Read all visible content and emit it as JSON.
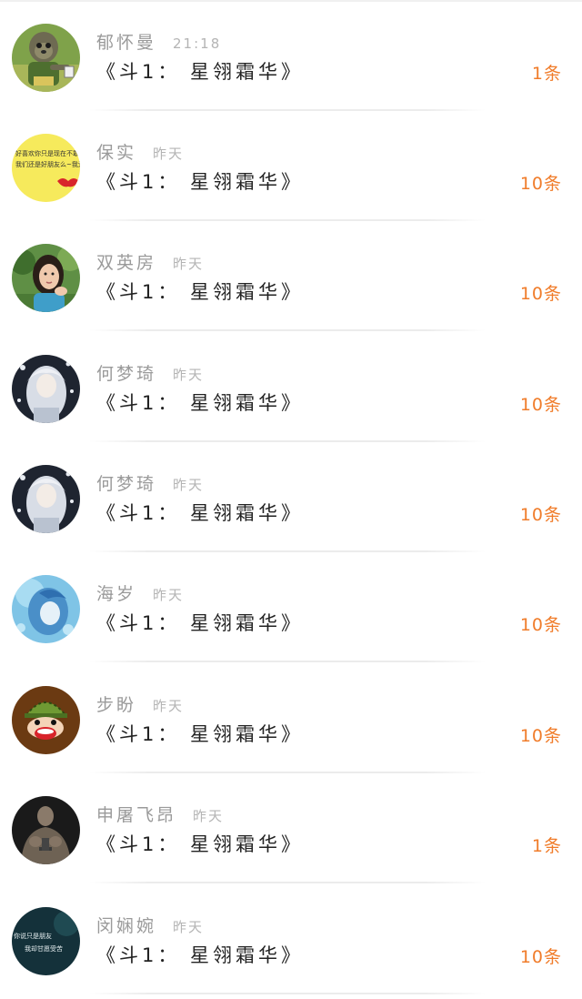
{
  "conversations": [
    {
      "name": "郁怀曼",
      "time": "21:18",
      "title": "《斗1： 星翎霜华》",
      "count": "1条",
      "avatar_icon": "zootopia-sloth-avatar"
    },
    {
      "name": "保实",
      "time": "昨天",
      "title": "《斗1： 星翎霜华》",
      "count": "10条",
      "avatar_icon": "yellow-handwriting-avatar"
    },
    {
      "name": "双英房",
      "time": "昨天",
      "title": "《斗1： 星翎霜华》",
      "count": "10条",
      "avatar_icon": "girl-photo-avatar"
    },
    {
      "name": "何梦琦",
      "time": "昨天",
      "title": "《斗1： 星翎霜华》",
      "count": "10条",
      "avatar_icon": "anime-white-hair-avatar"
    },
    {
      "name": "何梦琦",
      "time": "昨天",
      "title": "《斗1： 星翎霜华》",
      "count": "10条",
      "avatar_icon": "anime-white-hair-avatar"
    },
    {
      "name": "海岁",
      "time": "昨天",
      "title": "《斗1： 星翎霜华》",
      "count": "10条",
      "avatar_icon": "anime-blue-hair-avatar"
    },
    {
      "name": "步盼",
      "time": "昨天",
      "title": "《斗1： 星翎霜华》",
      "count": "10条",
      "avatar_icon": "cartoon-monkey-avatar"
    },
    {
      "name": "申屠飞昂",
      "time": "昨天",
      "title": "《斗1： 星翎霜华》",
      "count": "1条",
      "avatar_icon": "muscle-man-avatar"
    },
    {
      "name": "闵娴婉",
      "time": "昨天",
      "title": "《斗1： 星翎霜华》",
      "count": "10条",
      "avatar_icon": "dark-text-avatar"
    }
  ],
  "avatar_texts": {
    "yellow_note_line1": "好喜欢你只是现在不敢",
    "yellow_note_line2": "我们还是好朋友么~我爱你",
    "dark_text_line1": "你说只是朋友",
    "dark_text_line2": "我却甘愿受苦"
  },
  "colors": {
    "name": "#9a9a9a",
    "time": "#b4b4b4",
    "title": "#222222",
    "count": "#f07c2a",
    "divider": "#ececec"
  }
}
